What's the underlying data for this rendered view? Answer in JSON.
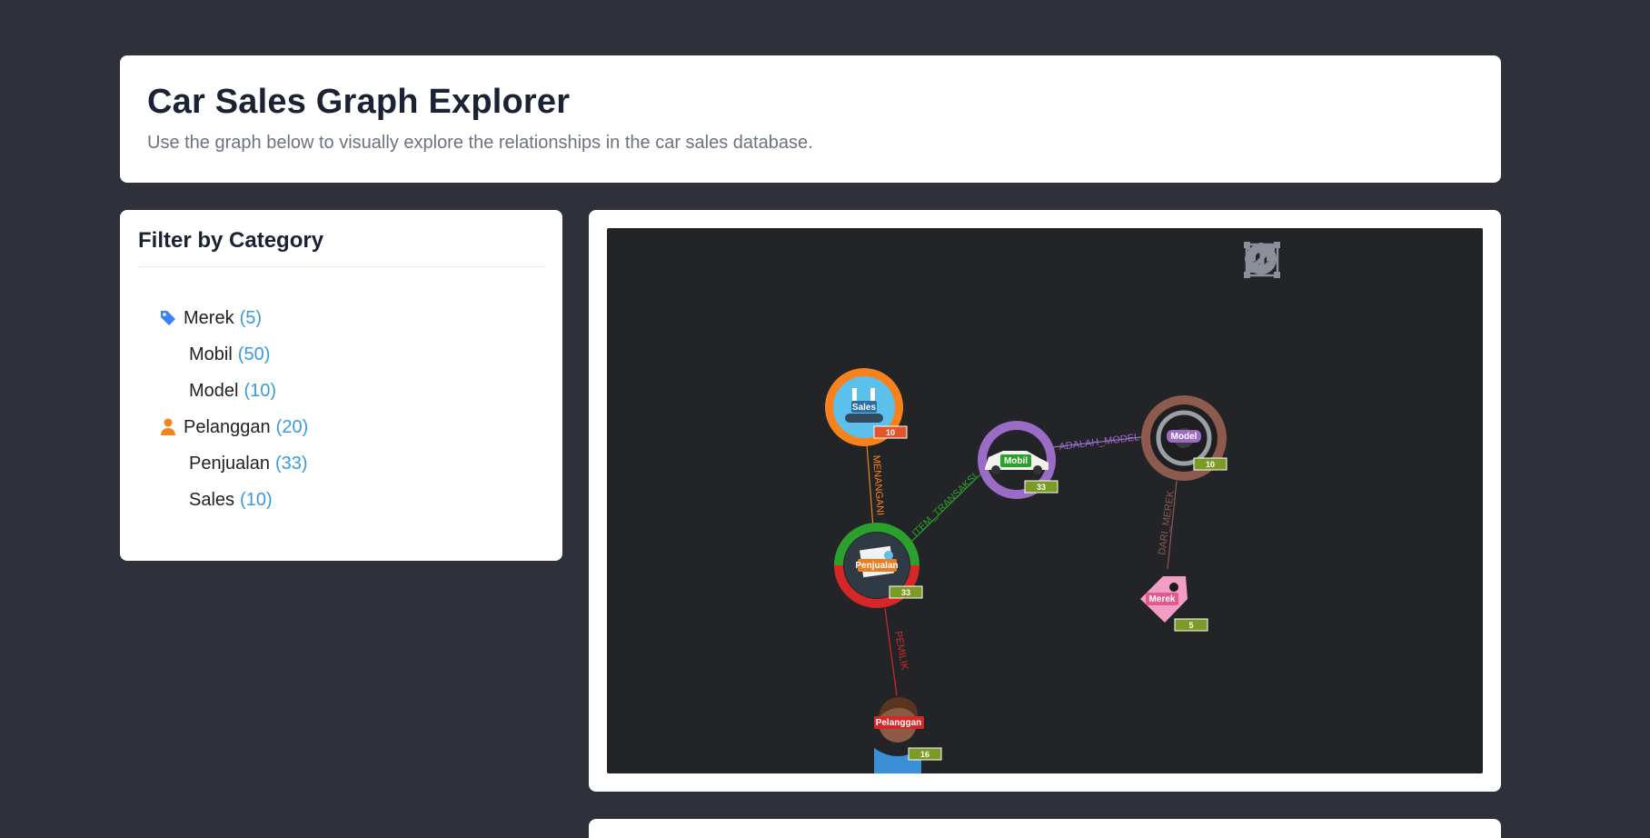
{
  "header": {
    "title": "Car Sales Graph Explorer",
    "subtitle": "Use the graph below to visually explore the relationships in the car sales database."
  },
  "filter": {
    "title": "Filter by Category",
    "items": [
      {
        "label": "Merek",
        "count": "(5)",
        "icon": "tag-icon"
      },
      {
        "label": "Mobil",
        "count": "(50)",
        "icon": ""
      },
      {
        "label": "Model",
        "count": "(10)",
        "icon": ""
      },
      {
        "label": "Pelanggan",
        "count": "(20)",
        "icon": "user-icon"
      },
      {
        "label": "Penjualan",
        "count": "(33)",
        "icon": ""
      },
      {
        "label": "Sales",
        "count": "(10)",
        "icon": ""
      }
    ]
  },
  "graph": {
    "toolbar": [
      "layout-icon",
      "reset-icon",
      "center-icon",
      "expand-icon",
      "text-toggle-icon"
    ],
    "nodes": {
      "sales": {
        "label": "Sales",
        "badge": "10",
        "ring": "#f7821b"
      },
      "mobil": {
        "label": "Mobil",
        "badge": "33",
        "ring": "#9b6cc6"
      },
      "model": {
        "label": "Model",
        "badge": "10",
        "ring": "#8d5a4e"
      },
      "penjualan": {
        "label": "Penjualan",
        "badge": "33",
        "ring": "#2ca02c"
      },
      "merek": {
        "label": "Merek",
        "badge": "5",
        "ring": "#f29ec4"
      },
      "pelanggan": {
        "label": "Pelanggan",
        "badge": "16",
        "ring": "#d62728"
      }
    },
    "edges": {
      "menangani": "MENANGANI",
      "item_transaksi": "ITEM_TRANSAKSI",
      "adalah_model": "ADALAH_MODEL",
      "dari_merek": "DARI_MEREK",
      "pemilik": "PEMILIK"
    }
  },
  "colors": {
    "accent": "#3b9ad9",
    "tag": "#3b82f6",
    "user": "#f7821b",
    "badge": "#7c9a26"
  }
}
